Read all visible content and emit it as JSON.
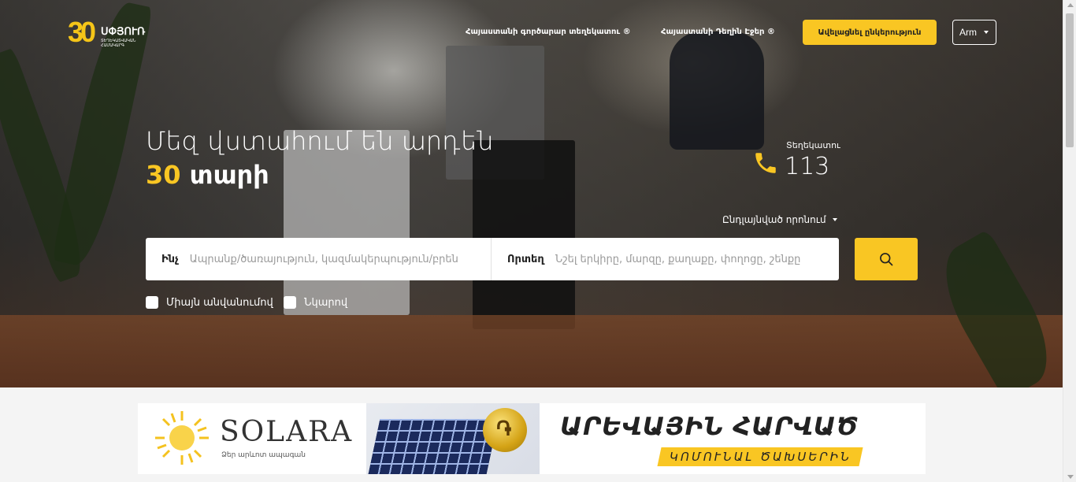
{
  "logo": {
    "number": "30",
    "name": "ՍՓՅՈՒՌ",
    "subtitle": "ՏԵՂԵԿԱՏՎԱԿԱՆ ՀԱՄԱԿԱՐԳ"
  },
  "nav": {
    "links": [
      {
        "label": "Հայաստանի գործարար տեղեկատու ®"
      },
      {
        "label": "Հայաստանի Դեղին Էջեր ®"
      }
    ],
    "add_company": "Ավելացնել ընկերություն",
    "language": "Arm"
  },
  "hero": {
    "headline_line1": "Մեզ վստահում են արդեն",
    "headline_number": "30",
    "headline_word": "տարի",
    "info_label": "Տեղեկատու",
    "info_number": "113",
    "advanced_search": "Ընդլայնված որոնում"
  },
  "search": {
    "what_label": "Ինչ",
    "what_placeholder": "Ապրանք/ծառայություն, կազմակերպություն/բրեն",
    "where_label": "Որտեղ",
    "where_placeholder": "Նշել երկիրը, մարզը, քաղաքը, փողոցը, շենքը"
  },
  "filters": [
    {
      "label": "Միայն անվանումով"
    },
    {
      "label": "Նկարով"
    }
  ],
  "banner": {
    "brand": "SOLARA",
    "brand_sub": "Ձեր արևոտ ապագան",
    "title": "ԱՐԵՎԱՅԻՆ ՀԱՐՎԱԾ",
    "subtitle": "ԿՈՄՈՒՆԱԼ ԾԱԽՍԵՐԻՆ"
  },
  "colors": {
    "accent": "#f9c623",
    "text_dark": "#222222"
  }
}
